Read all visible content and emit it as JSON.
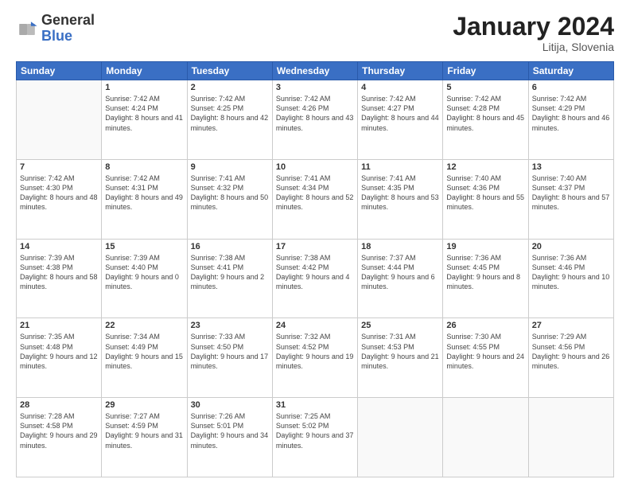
{
  "header": {
    "logo_general": "General",
    "logo_blue": "Blue",
    "month_year": "January 2024",
    "location": "Litija, Slovenia"
  },
  "weekdays": [
    "Sunday",
    "Monday",
    "Tuesday",
    "Wednesday",
    "Thursday",
    "Friday",
    "Saturday"
  ],
  "weeks": [
    [
      {
        "day": "",
        "empty": true
      },
      {
        "day": "1",
        "sunrise": "7:42 AM",
        "sunset": "4:24 PM",
        "daylight": "8 hours and 41 minutes."
      },
      {
        "day": "2",
        "sunrise": "7:42 AM",
        "sunset": "4:25 PM",
        "daylight": "8 hours and 42 minutes."
      },
      {
        "day": "3",
        "sunrise": "7:42 AM",
        "sunset": "4:26 PM",
        "daylight": "8 hours and 43 minutes."
      },
      {
        "day": "4",
        "sunrise": "7:42 AM",
        "sunset": "4:27 PM",
        "daylight": "8 hours and 44 minutes."
      },
      {
        "day": "5",
        "sunrise": "7:42 AM",
        "sunset": "4:28 PM",
        "daylight": "8 hours and 45 minutes."
      },
      {
        "day": "6",
        "sunrise": "7:42 AM",
        "sunset": "4:29 PM",
        "daylight": "8 hours and 46 minutes."
      }
    ],
    [
      {
        "day": "7",
        "sunrise": "7:42 AM",
        "sunset": "4:30 PM",
        "daylight": "8 hours and 48 minutes."
      },
      {
        "day": "8",
        "sunrise": "7:42 AM",
        "sunset": "4:31 PM",
        "daylight": "8 hours and 49 minutes."
      },
      {
        "day": "9",
        "sunrise": "7:41 AM",
        "sunset": "4:32 PM",
        "daylight": "8 hours and 50 minutes."
      },
      {
        "day": "10",
        "sunrise": "7:41 AM",
        "sunset": "4:34 PM",
        "daylight": "8 hours and 52 minutes."
      },
      {
        "day": "11",
        "sunrise": "7:41 AM",
        "sunset": "4:35 PM",
        "daylight": "8 hours and 53 minutes."
      },
      {
        "day": "12",
        "sunrise": "7:40 AM",
        "sunset": "4:36 PM",
        "daylight": "8 hours and 55 minutes."
      },
      {
        "day": "13",
        "sunrise": "7:40 AM",
        "sunset": "4:37 PM",
        "daylight": "8 hours and 57 minutes."
      }
    ],
    [
      {
        "day": "14",
        "sunrise": "7:39 AM",
        "sunset": "4:38 PM",
        "daylight": "8 hours and 58 minutes."
      },
      {
        "day": "15",
        "sunrise": "7:39 AM",
        "sunset": "4:40 PM",
        "daylight": "9 hours and 0 minutes."
      },
      {
        "day": "16",
        "sunrise": "7:38 AM",
        "sunset": "4:41 PM",
        "daylight": "9 hours and 2 minutes."
      },
      {
        "day": "17",
        "sunrise": "7:38 AM",
        "sunset": "4:42 PM",
        "daylight": "9 hours and 4 minutes."
      },
      {
        "day": "18",
        "sunrise": "7:37 AM",
        "sunset": "4:44 PM",
        "daylight": "9 hours and 6 minutes."
      },
      {
        "day": "19",
        "sunrise": "7:36 AM",
        "sunset": "4:45 PM",
        "daylight": "9 hours and 8 minutes."
      },
      {
        "day": "20",
        "sunrise": "7:36 AM",
        "sunset": "4:46 PM",
        "daylight": "9 hours and 10 minutes."
      }
    ],
    [
      {
        "day": "21",
        "sunrise": "7:35 AM",
        "sunset": "4:48 PM",
        "daylight": "9 hours and 12 minutes."
      },
      {
        "day": "22",
        "sunrise": "7:34 AM",
        "sunset": "4:49 PM",
        "daylight": "9 hours and 15 minutes."
      },
      {
        "day": "23",
        "sunrise": "7:33 AM",
        "sunset": "4:50 PM",
        "daylight": "9 hours and 17 minutes."
      },
      {
        "day": "24",
        "sunrise": "7:32 AM",
        "sunset": "4:52 PM",
        "daylight": "9 hours and 19 minutes."
      },
      {
        "day": "25",
        "sunrise": "7:31 AM",
        "sunset": "4:53 PM",
        "daylight": "9 hours and 21 minutes."
      },
      {
        "day": "26",
        "sunrise": "7:30 AM",
        "sunset": "4:55 PM",
        "daylight": "9 hours and 24 minutes."
      },
      {
        "day": "27",
        "sunrise": "7:29 AM",
        "sunset": "4:56 PM",
        "daylight": "9 hours and 26 minutes."
      }
    ],
    [
      {
        "day": "28",
        "sunrise": "7:28 AM",
        "sunset": "4:58 PM",
        "daylight": "9 hours and 29 minutes."
      },
      {
        "day": "29",
        "sunrise": "7:27 AM",
        "sunset": "4:59 PM",
        "daylight": "9 hours and 31 minutes."
      },
      {
        "day": "30",
        "sunrise": "7:26 AM",
        "sunset": "5:01 PM",
        "daylight": "9 hours and 34 minutes."
      },
      {
        "day": "31",
        "sunrise": "7:25 AM",
        "sunset": "5:02 PM",
        "daylight": "9 hours and 37 minutes."
      },
      {
        "day": "",
        "empty": true
      },
      {
        "day": "",
        "empty": true
      },
      {
        "day": "",
        "empty": true
      }
    ]
  ],
  "labels": {
    "sunrise": "Sunrise:",
    "sunset": "Sunset:",
    "daylight": "Daylight:"
  }
}
